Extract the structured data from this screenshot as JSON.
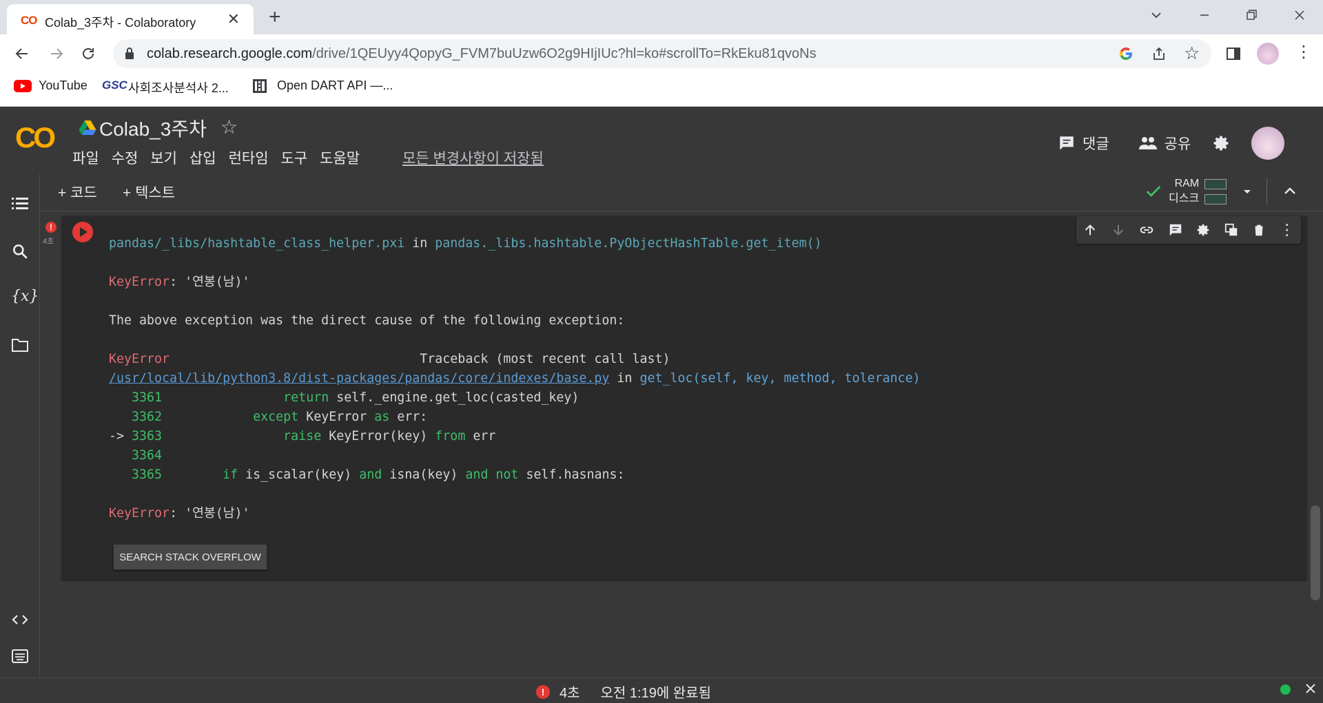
{
  "browser": {
    "tab_title": "Colab_3주차 - Colaboratory",
    "tab_favicon": "CO",
    "url_host": "colab.research.google.com",
    "url_path": "/drive/1QEUyy4QopyG_FVM7buUzw6O2g9HIjIUc?hl=ko#scrollTo=RkEku81qvoNs",
    "bookmarks": [
      {
        "label": "YouTube",
        "icon": "youtube-icon"
      },
      {
        "label": "사회조사분석사 2...",
        "icon": "gsc-icon"
      },
      {
        "label": "Open DART API —...",
        "icon": "dart-icon"
      }
    ],
    "bookmark_badge": "GSC"
  },
  "colab": {
    "logo": "CO",
    "notebook_title": "Colab_3주차",
    "menus": [
      "파일",
      "수정",
      "보기",
      "삽입",
      "런타임",
      "도구",
      "도움말"
    ],
    "save_status": "모든 변경사항이 저장됨",
    "comment_label": "댓글",
    "share_label": "공유",
    "add_code": "코드",
    "add_text": "텍스트",
    "ram_label": "RAM",
    "disk_label": "디스크",
    "exec_time": "4초"
  },
  "output": {
    "line1_path": "pandas/_libs/hashtable_class_helper.pxi",
    "line1_in": " in ",
    "line1_func": "pandas._libs.hashtable.PyObjectHashTable.get_item()",
    "keyerror": "KeyError",
    "keyerror_msg": ": '연봉(남)'",
    "cause_text": "The above exception was the direct cause of the following exception:",
    "tb_label": "Traceback (most recent call last)",
    "file_link": "/usr/local/lib/python3.8/dist-packages/pandas/core/indexes/base.py",
    "file_in": " in ",
    "file_func": "get_loc(self, key, method, tolerance)",
    "lines": [
      {
        "num": "3361",
        "arrow": "   ",
        "indent": "                ",
        "kw": "return",
        "rest": " self._engine.get_loc(casted_key)"
      },
      {
        "num": "3362",
        "arrow": "   ",
        "indent": "            ",
        "kw": "except",
        "rest": " KeyError ",
        "kw2": "as",
        "rest2": " err:"
      },
      {
        "num": "3363",
        "arrow": "-> ",
        "indent": "                ",
        "kw": "raise",
        "rest": " KeyError(key) ",
        "kw2": "from",
        "rest2": " err"
      },
      {
        "num": "3364",
        "arrow": "   ",
        "indent": "",
        "kw": "",
        "rest": ""
      },
      {
        "num": "3365",
        "arrow": "   ",
        "indent": "        ",
        "kw": "if",
        "rest": " is_scalar(key) ",
        "kw2": "and",
        "rest2": " isna(key) ",
        "kw3": "and not",
        "rest3": " self.hasnans:"
      }
    ],
    "so_button": "SEARCH STACK OVERFLOW"
  },
  "status": {
    "duration": "4초",
    "completed": "오전 1:19에 완료됨"
  },
  "colors": {
    "error_red": "#e06b74",
    "keyword_green": "#3fbf6a",
    "link_blue": "#5a9bd5",
    "logo_orange": "#f9ab00",
    "bg_dark": "#383838"
  }
}
